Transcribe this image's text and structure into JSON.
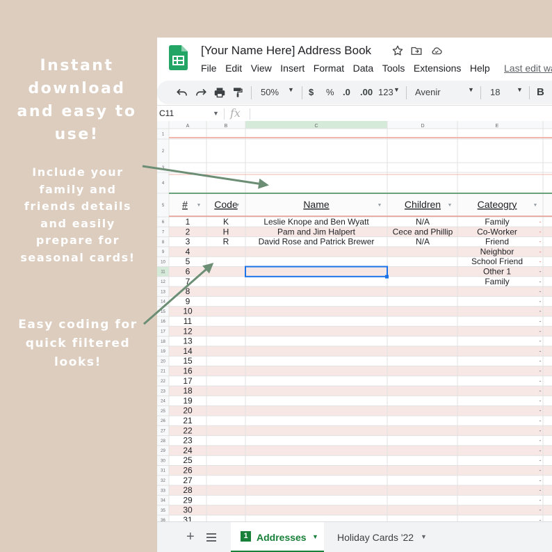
{
  "promo": {
    "headline": [
      "Instant",
      "download",
      "and easy to",
      "use!"
    ],
    "note1": [
      "Include your",
      "family and",
      "friends details",
      "and easily",
      "prepare for",
      "seasonal cards!"
    ],
    "note2": [
      "Easy coding for",
      "quick filtered",
      "looks!"
    ]
  },
  "app": {
    "title": "[Your Name Here] Address Book",
    "menu": [
      "File",
      "Edit",
      "View",
      "Insert",
      "Format",
      "Data",
      "Tools",
      "Extensions",
      "Help"
    ],
    "last_edit": "Last edit wa",
    "toolbar": {
      "zoom": "50%",
      "currency": "$",
      "percent": "%",
      "dec_less": ".0",
      "dec_more": ".00",
      "number_format": "123",
      "font": "Avenir",
      "font_size": "18",
      "bold": "B"
    },
    "cell_ref": "C11",
    "fx": "fx",
    "column_letters": [
      "A",
      "B",
      "C",
      "D",
      "E"
    ],
    "headers": [
      "#",
      "Code",
      "Name",
      "Children",
      "Cateogry"
    ],
    "rows": [
      [
        "1",
        "K",
        "Leslie Knope and Ben Wyatt",
        "N/A",
        "Family"
      ],
      [
        "2",
        "H",
        "Pam and Jim Halpert",
        "Cece and Phillip",
        "Co-Worker"
      ],
      [
        "3",
        "R",
        "David Rose and Patrick Brewer",
        "N/A",
        "Friend"
      ],
      [
        "4",
        "",
        "",
        "",
        "Neighbor"
      ],
      [
        "5",
        "",
        "",
        "",
        "School Friend"
      ],
      [
        "6",
        "",
        "",
        "",
        "Other 1"
      ],
      [
        "7",
        "",
        "",
        "",
        "Family"
      ],
      [
        "8",
        "",
        "",
        "",
        ""
      ],
      [
        "9",
        "",
        "",
        "",
        ""
      ],
      [
        "10",
        "",
        "",
        "",
        ""
      ],
      [
        "11",
        "",
        "",
        "",
        ""
      ],
      [
        "12",
        "",
        "",
        "",
        ""
      ],
      [
        "13",
        "",
        "",
        "",
        ""
      ],
      [
        "14",
        "",
        "",
        "",
        ""
      ],
      [
        "15",
        "",
        "",
        "",
        ""
      ],
      [
        "16",
        "",
        "",
        "",
        ""
      ],
      [
        "17",
        "",
        "",
        "",
        ""
      ],
      [
        "18",
        "",
        "",
        "",
        ""
      ],
      [
        "19",
        "",
        "",
        "",
        ""
      ],
      [
        "20",
        "",
        "",
        "",
        ""
      ],
      [
        "21",
        "",
        "",
        "",
        ""
      ],
      [
        "22",
        "",
        "",
        "",
        ""
      ],
      [
        "23",
        "",
        "",
        "",
        ""
      ],
      [
        "24",
        "",
        "",
        "",
        ""
      ],
      [
        "25",
        "",
        "",
        "",
        ""
      ],
      [
        "26",
        "",
        "",
        "",
        ""
      ],
      [
        "27",
        "",
        "",
        "",
        ""
      ],
      [
        "28",
        "",
        "",
        "",
        ""
      ],
      [
        "29",
        "",
        "",
        "",
        ""
      ],
      [
        "30",
        "",
        "",
        "",
        ""
      ],
      [
        "31",
        "",
        "",
        "",
        ""
      ]
    ],
    "row_dash": "-",
    "tabs": {
      "active": "Addresses",
      "active_badge": "1",
      "other": "Holiday Cards '22"
    },
    "colors": {
      "accent_green": "#188038",
      "row_pink": "#f7e8e6",
      "header_line": "#6aa07a",
      "selection": "#1a73e8",
      "arrow": "#6b8e75"
    }
  }
}
